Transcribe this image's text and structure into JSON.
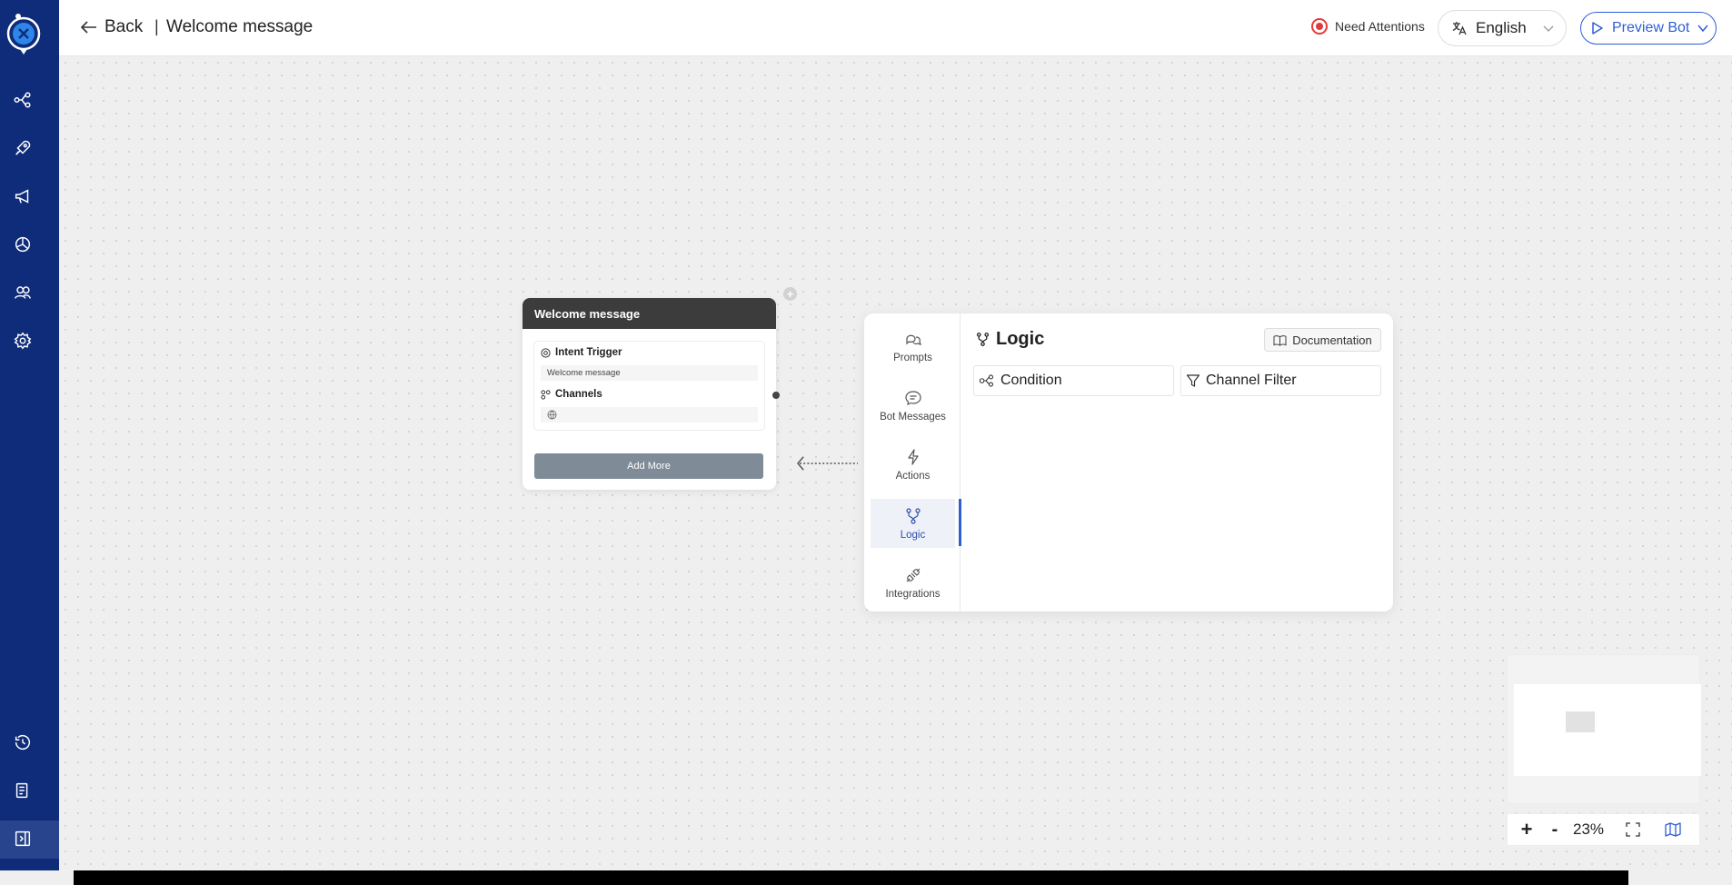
{
  "header": {
    "back_label": "Back",
    "separator": "|",
    "page_title": "Welcome message",
    "attention_label": "Need Attentions",
    "language": "English",
    "preview_label": "Preview Bot"
  },
  "sidebar": {
    "icons": [
      "flow-icon",
      "rocket-icon",
      "megaphone-icon",
      "analytics-icon",
      "users-icon",
      "settings-icon",
      "history-icon",
      "document-icon",
      "collapse-icon"
    ]
  },
  "node": {
    "title": "Welcome message",
    "intent_label": "Intent Trigger",
    "intent_value": "Welcome message",
    "channels_label": "Channels",
    "add_more": "Add More"
  },
  "panel": {
    "nav": [
      {
        "label": "Prompts",
        "icon": "chat-icon"
      },
      {
        "label": "Bot Messages",
        "icon": "message-icon"
      },
      {
        "label": "Actions",
        "icon": "lightning-icon"
      },
      {
        "label": "Logic",
        "icon": "logic-icon",
        "active": true
      },
      {
        "label": "Integrations",
        "icon": "plug-icon"
      }
    ],
    "title": "Logic",
    "doc_label": "Documentation",
    "options": [
      {
        "label": "Condition",
        "icon": "condition-icon"
      },
      {
        "label": "Channel Filter",
        "icon": "filter-icon"
      }
    ]
  },
  "zoom": {
    "plus": "+",
    "minus": "-",
    "level": "23%"
  },
  "colors": {
    "sidebar": "#0f2c7a",
    "accent": "#2f5dd6",
    "node_header": "#3c3c3c",
    "attention": "#e23b3b"
  }
}
